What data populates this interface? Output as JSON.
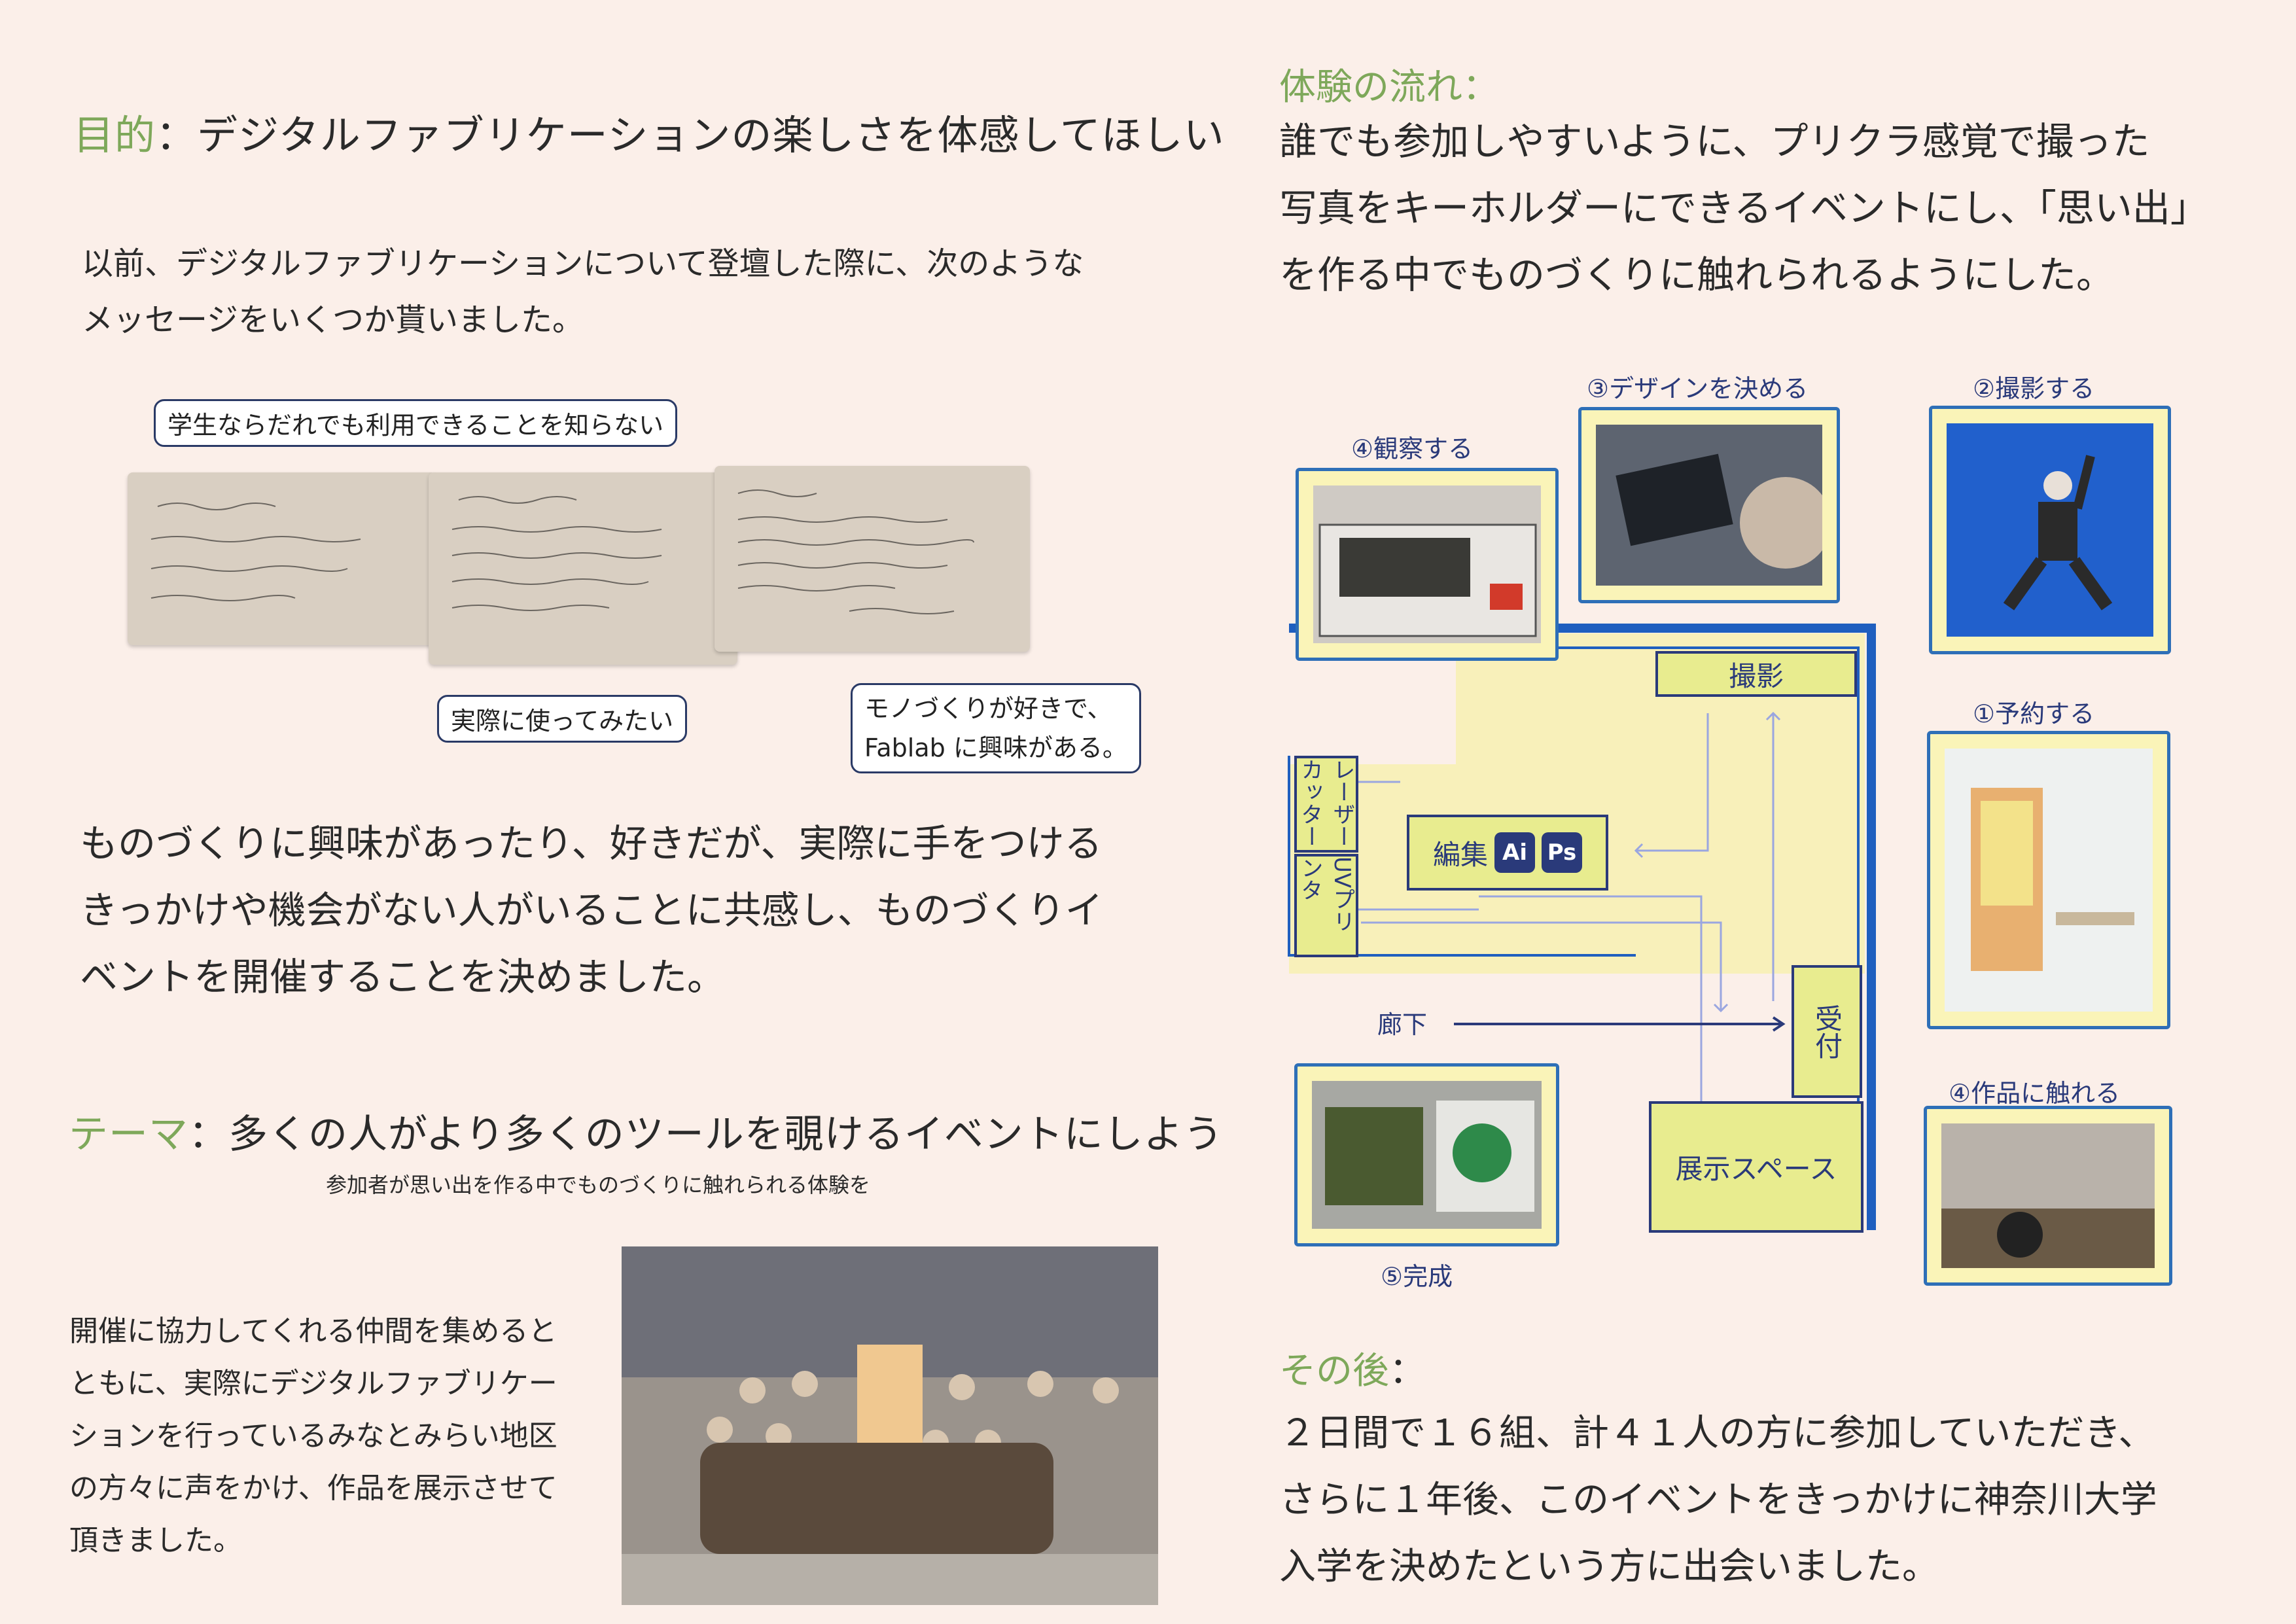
{
  "left": {
    "purpose": {
      "label": "目的",
      "colon": "：",
      "text": "デジタルファブリケーションの楽しさを体感してほしい"
    },
    "intro": [
      "以前、デジタルファブリケーションについて登壇した際に、次のような",
      "メッセージをいくつか貰いました。"
    ],
    "bubbles": {
      "b1": "学生ならだれでも利用できることを知らない",
      "b2": "実際に使ってみたい",
      "b3a": "モノづくりが好きで、",
      "b3b": "Fablab に興味がある。"
    },
    "empathy": [
      "ものづくりに興味があったり、好きだが、実際に手をつける",
      "きっかけや機会がない人がいることに共感し、ものづくりイ",
      "ベントを開催することを決めました。"
    ],
    "theme": {
      "label": "テーマ",
      "colon": "：",
      "text": "多くの人がより多くのツールを覗けるイベントにしよう",
      "sub": "参加者が思い出を作る中でものづくりに触れられる体験を"
    },
    "cooperation": [
      "開催に協力してくれる仲間を集めると",
      "ともに、実際にデジタルファブリケー",
      "ションを行っているみなとみらい地区",
      "の方々に声をかけ、作品を展示させて",
      "頂きました。"
    ]
  },
  "right": {
    "flow": {
      "label": "体験の流れ",
      "colon": "：",
      "lines": [
        "誰でも参加しやすいように、プリクラ感覚で撮った",
        "写真をキーホルダーにできるイベントにし、「思い出」",
        "を作る中でものづくりに触れられるようにした。"
      ]
    },
    "steps": {
      "s4a": "④観察する",
      "s3": "③デザインを決める",
      "s2": "②撮影する",
      "s1": "①予約する",
      "s4b": "④作品に触れる",
      "s5": "⑤完成"
    },
    "map": {
      "photo": "撮影",
      "edit": "編集",
      "ai": "Ai",
      "ps": "Ps",
      "laser": "レーザーカッター",
      "uv": "UVプリンタ",
      "corridor": "廊下",
      "reception": "受付",
      "exhibit": "展示スペース"
    },
    "after": {
      "label": "その後",
      "colon": "：",
      "lines": [
        "２日間で１６組、計４１人の方に参加していただき、",
        "さらに１年後、このイベントをきっかけに神奈川大学",
        "入学を決めたという方に出会いました。"
      ]
    }
  },
  "colors": {
    "accent": "#7ea85a",
    "frame": "#2e6fb7",
    "navy": "#2a3a7a",
    "background": "#fbefe9"
  }
}
